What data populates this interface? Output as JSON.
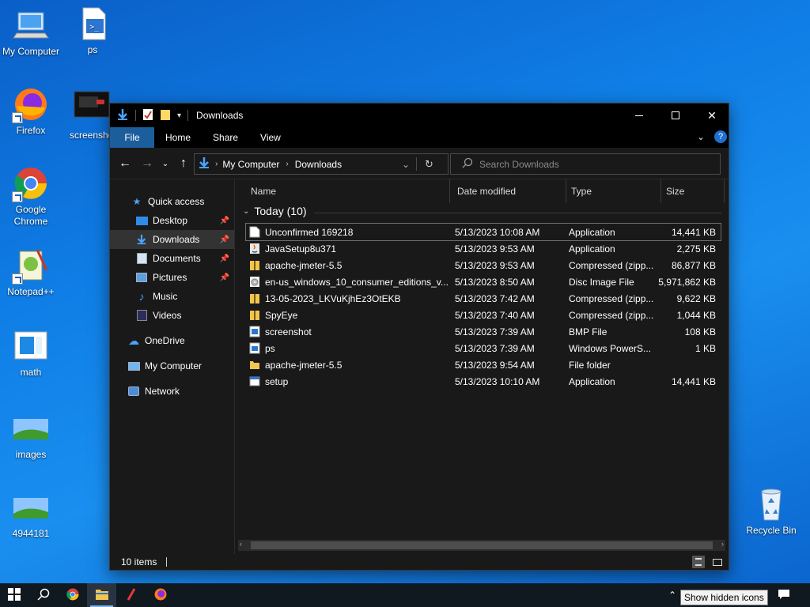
{
  "desktop": {
    "icons": [
      {
        "label": "My Computer"
      },
      {
        "label": "ps"
      },
      {
        "label": "Firefox"
      },
      {
        "label": "screenshot"
      },
      {
        "label": "Google Chrome"
      },
      {
        "label": "Notepad++"
      },
      {
        "label": "math"
      },
      {
        "label": "images"
      },
      {
        "label": "4944181"
      },
      {
        "label": "Recycle Bin"
      }
    ]
  },
  "window": {
    "title": "Downloads",
    "ribbon_tabs": [
      "File",
      "Home",
      "Share",
      "View"
    ],
    "address": {
      "segments": [
        "My Computer",
        "Downloads"
      ]
    },
    "search": {
      "placeholder": "Search Downloads"
    },
    "nav": [
      {
        "label": "Quick access"
      },
      {
        "label": "Desktop",
        "pinned": true
      },
      {
        "label": "Downloads",
        "pinned": true,
        "selected": true
      },
      {
        "label": "Documents",
        "pinned": true
      },
      {
        "label": "Pictures",
        "pinned": true
      },
      {
        "label": "Music"
      },
      {
        "label": "Videos"
      },
      {
        "label": "OneDrive"
      },
      {
        "label": "My Computer"
      },
      {
        "label": "Network"
      }
    ],
    "columns": [
      "Name",
      "Date modified",
      "Type",
      "Size"
    ],
    "group": "Today (10)",
    "files": [
      {
        "name": "Unconfirmed 169218",
        "date": "5/13/2023 10:08 AM",
        "type": "Application",
        "size": "14,441 KB",
        "icon": "blank-file-icon"
      },
      {
        "name": "JavaSetup8u371",
        "date": "5/13/2023 9:53 AM",
        "type": "Application",
        "size": "2,275 KB",
        "icon": "java-icon"
      },
      {
        "name": "apache-jmeter-5.5",
        "date": "5/13/2023 9:53 AM",
        "type": "Compressed (zipp...",
        "size": "86,877 KB",
        "icon": "zip-folder-icon"
      },
      {
        "name": "en-us_windows_10_consumer_editions_v...",
        "date": "5/13/2023 8:50 AM",
        "type": "Disc Image File",
        "size": "5,971,862 KB",
        "icon": "disc-image-icon"
      },
      {
        "name": "13-05-2023_LKVuKjhEz3OtEKB",
        "date": "5/13/2023 7:42 AM",
        "type": "Compressed (zipp...",
        "size": "9,622 KB",
        "icon": "zip-folder-icon"
      },
      {
        "name": "SpyEye",
        "date": "5/13/2023 7:40 AM",
        "type": "Compressed (zipp...",
        "size": "1,044 KB",
        "icon": "zip-folder-icon"
      },
      {
        "name": "screenshot",
        "date": "5/13/2023 7:39 AM",
        "type": "BMP File",
        "size": "108 KB",
        "icon": "bmp-icon"
      },
      {
        "name": "ps",
        "date": "5/13/2023 7:39 AM",
        "type": "Windows PowerS...",
        "size": "1 KB",
        "icon": "powershell-script-icon"
      },
      {
        "name": "apache-jmeter-5.5",
        "date": "5/13/2023 9:54 AM",
        "type": "File folder",
        "size": "",
        "icon": "folder-icon"
      },
      {
        "name": "setup",
        "date": "5/13/2023 10:10 AM",
        "type": "Application",
        "size": "14,441 KB",
        "icon": "setup-app-icon"
      }
    ],
    "status": {
      "items": "10 items"
    }
  },
  "taskbar": {
    "tooltip": "Show hidden icons"
  },
  "colors": {
    "file_tab": "#1c5e9c",
    "window_bg": "#191919",
    "desktop_blue": "#0f7ee6"
  }
}
